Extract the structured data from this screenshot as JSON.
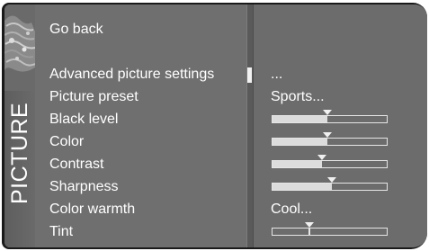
{
  "side": {
    "label": "PICTURE"
  },
  "menu": {
    "go_back": "Go back",
    "items": [
      {
        "label": "Advanced picture settings",
        "value": "..."
      },
      {
        "label": "Picture preset",
        "value": "Sports..."
      },
      {
        "label": "Black level",
        "level": 0.48
      },
      {
        "label": "Color",
        "level": 0.48
      },
      {
        "label": "Contrast",
        "level": 0.43
      },
      {
        "label": "Sharpness",
        "level": 0.52
      },
      {
        "label": "Color warmth",
        "value": "Cool..."
      },
      {
        "label": "Tint",
        "level": 0.32,
        "centered": true
      }
    ]
  }
}
